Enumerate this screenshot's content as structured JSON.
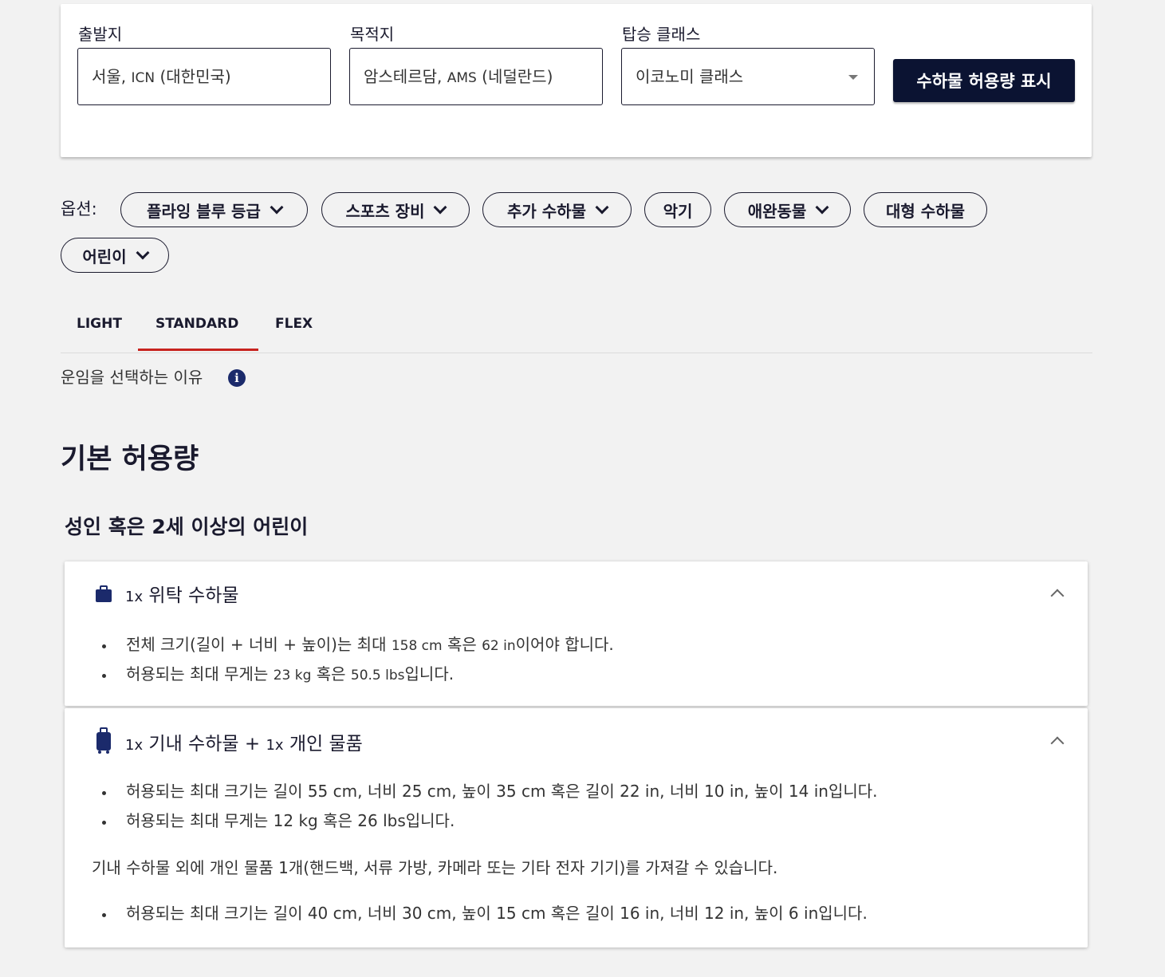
{
  "search": {
    "origin_label": "출발지",
    "origin_value_ko": "서울, ",
    "origin_value_code": "ICN",
    "origin_value_country": " (대한민국)",
    "destination_label": "목적지",
    "destination_value_ko": "암스테르담, ",
    "destination_value_code": "AMS",
    "destination_value_country": " (네덜란드)",
    "class_label": "탑승 클래스",
    "class_value": "이코노미 클래스",
    "show_button": "수하물 허용량 표시"
  },
  "options": {
    "label": "옵션:",
    "chips": [
      {
        "label": "플라잉 블루 등급",
        "has_dropdown": true
      },
      {
        "label": "스포츠 장비",
        "has_dropdown": true
      },
      {
        "label": "추가 수하물",
        "has_dropdown": true
      },
      {
        "label": "악기",
        "has_dropdown": false
      },
      {
        "label": "애완동물",
        "has_dropdown": true
      },
      {
        "label": "대형 수하물",
        "has_dropdown": false
      },
      {
        "label": "어린이",
        "has_dropdown": true
      }
    ]
  },
  "tabs": {
    "items": [
      "LIGHT",
      "STANDARD",
      "FLEX"
    ],
    "active": "STANDARD"
  },
  "why_fare": "운임을 선택하는 이유",
  "section_title": "기본 허용량",
  "sub_title": "성인 혹은 2세 이상의 어린이",
  "checked_bag": {
    "qty": "1x",
    "title": " 위탁 수하물",
    "bullets": [
      {
        "a": "전체 크기(길이 + 너비 + 높이)는 최대 ",
        "b": "158 cm",
        "c": " 혹은 ",
        "d": "62 in",
        "e": "이어야 합니다."
      },
      {
        "a": "허용되는 최대 무게는 ",
        "b": "23 kg",
        "c": " 혹은 ",
        "d": "50.5 lbs",
        "e": "입니다."
      }
    ]
  },
  "cabin_bag": {
    "qty1": "1x",
    "title1": " 기내 수하물 + ",
    "qty2": "1x",
    "title2": " 개인 물품",
    "bullets": [
      "허용되는 최대 크기는 길이 55 cm, 너비 25 cm, 높이 35 cm 혹은 길이 22 in, 너비 10 in, 높이 14 in입니다.",
      "허용되는 최대 무게는 12 kg 혹은 26 lbs입니다."
    ],
    "personal_item_note": "기내 수하물 외에 개인 물품 1개(핸드백, 서류 가방, 카메라 또는 기타 전자 기기)를 가져갈 수 있습니다.",
    "personal_bullets": [
      "허용되는 최대 크기는 길이 40 cm, 너비 30 cm, 높이 15 cm 혹은 길이 16 in, 너비 12 in, 높이 6 in입니다."
    ]
  },
  "colors": {
    "brand_navy": "#0b1332",
    "active_tab_red": "#c8231f",
    "icon_blue": "#1b2a6b"
  }
}
